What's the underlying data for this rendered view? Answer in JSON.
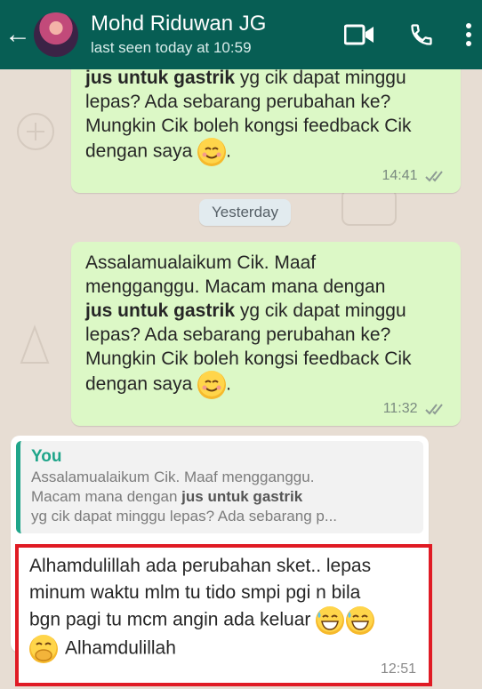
{
  "header": {
    "contact_name": "Mohd Riduwan JG",
    "status": "last seen today at 10:59",
    "back_glyph": "←",
    "video_icon": "video-call-icon",
    "call_icon": "phone-icon",
    "menu_icon": "more-vert-icon",
    "color": "#075e54"
  },
  "messages": {
    "first": {
      "line1_bold": "jus untuk gastrik",
      "line1_rest": " yg cik dapat minggu",
      "line2": "lepas? Ada sebarang perubahan ke?",
      "line3": "Mungkin Cik boleh kongsi feedback Cik",
      "line4": "dengan saya",
      "time": "14:41"
    },
    "date_divider": "Yesterday",
    "second": {
      "line1": "Assalamualaikum Cik. Maaf",
      "line2": "mengganggu. Macam mana dengan",
      "line3_bold": "jus untuk gastrik",
      "line3_rest": " yg cik dapat minggu",
      "line4": "lepas? Ada sebarang perubahan ke?",
      "line5": "Mungkin Cik boleh kongsi feedback Cik",
      "line6": "dengan saya",
      "time": "11:32"
    },
    "reply": {
      "quote_author": "You",
      "quote_line1": "Assalamualaikum Cik. Maaf mengganggu.",
      "quote_line2_pre": "Macam mana dengan ",
      "quote_line2_bold": "jus untuk gastrik",
      "quote_line3": "yg cik dapat minggu lepas? Ada sebarang p...",
      "line1": "Alhamdulillah ada perubahan sket.. lepas",
      "line2": "minum waktu mlm tu tido smpi pgi n bila",
      "line3": "bgn pagi tu mcm angin ada keluar",
      "line4": "Alhamdulillah",
      "time": "12:51"
    }
  },
  "colors": {
    "outgoing_bubble": "#dcf8c6",
    "incoming_bubble": "#ffffff",
    "highlight_border": "#e01b24",
    "quote_accent": "#1fa58a"
  }
}
